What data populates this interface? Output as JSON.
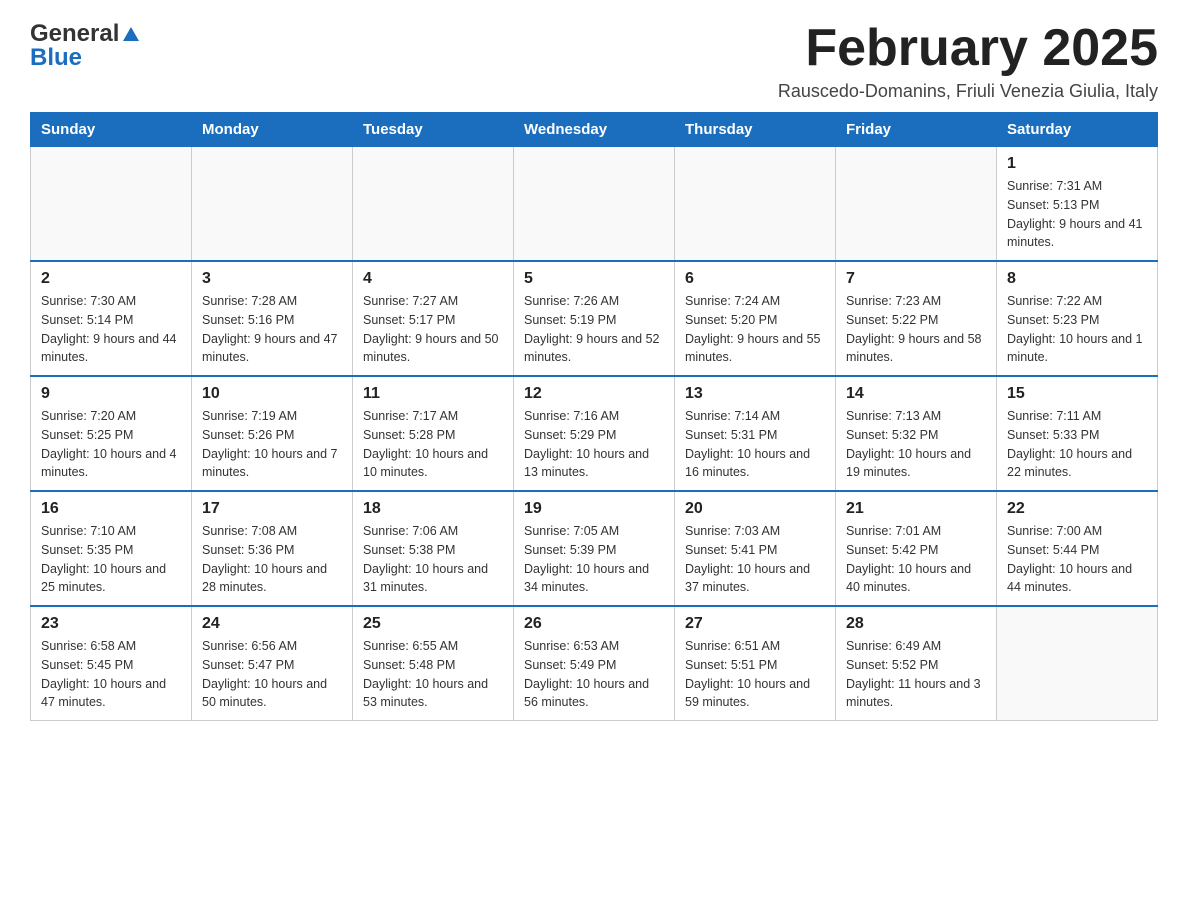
{
  "logo": {
    "general": "General",
    "blue": "Blue",
    "triangle": "▲"
  },
  "header": {
    "month_title": "February 2025",
    "location": "Rauscedo-Domanins, Friuli Venezia Giulia, Italy"
  },
  "weekdays": [
    "Sunday",
    "Monday",
    "Tuesday",
    "Wednesday",
    "Thursday",
    "Friday",
    "Saturday"
  ],
  "weeks": [
    {
      "days": [
        {
          "number": "",
          "info": ""
        },
        {
          "number": "",
          "info": ""
        },
        {
          "number": "",
          "info": ""
        },
        {
          "number": "",
          "info": ""
        },
        {
          "number": "",
          "info": ""
        },
        {
          "number": "",
          "info": ""
        },
        {
          "number": "1",
          "info": "Sunrise: 7:31 AM\nSunset: 5:13 PM\nDaylight: 9 hours and 41 minutes."
        }
      ]
    },
    {
      "days": [
        {
          "number": "2",
          "info": "Sunrise: 7:30 AM\nSunset: 5:14 PM\nDaylight: 9 hours and 44 minutes."
        },
        {
          "number": "3",
          "info": "Sunrise: 7:28 AM\nSunset: 5:16 PM\nDaylight: 9 hours and 47 minutes."
        },
        {
          "number": "4",
          "info": "Sunrise: 7:27 AM\nSunset: 5:17 PM\nDaylight: 9 hours and 50 minutes."
        },
        {
          "number": "5",
          "info": "Sunrise: 7:26 AM\nSunset: 5:19 PM\nDaylight: 9 hours and 52 minutes."
        },
        {
          "number": "6",
          "info": "Sunrise: 7:24 AM\nSunset: 5:20 PM\nDaylight: 9 hours and 55 minutes."
        },
        {
          "number": "7",
          "info": "Sunrise: 7:23 AM\nSunset: 5:22 PM\nDaylight: 9 hours and 58 minutes."
        },
        {
          "number": "8",
          "info": "Sunrise: 7:22 AM\nSunset: 5:23 PM\nDaylight: 10 hours and 1 minute."
        }
      ]
    },
    {
      "days": [
        {
          "number": "9",
          "info": "Sunrise: 7:20 AM\nSunset: 5:25 PM\nDaylight: 10 hours and 4 minutes."
        },
        {
          "number": "10",
          "info": "Sunrise: 7:19 AM\nSunset: 5:26 PM\nDaylight: 10 hours and 7 minutes."
        },
        {
          "number": "11",
          "info": "Sunrise: 7:17 AM\nSunset: 5:28 PM\nDaylight: 10 hours and 10 minutes."
        },
        {
          "number": "12",
          "info": "Sunrise: 7:16 AM\nSunset: 5:29 PM\nDaylight: 10 hours and 13 minutes."
        },
        {
          "number": "13",
          "info": "Sunrise: 7:14 AM\nSunset: 5:31 PM\nDaylight: 10 hours and 16 minutes."
        },
        {
          "number": "14",
          "info": "Sunrise: 7:13 AM\nSunset: 5:32 PM\nDaylight: 10 hours and 19 minutes."
        },
        {
          "number": "15",
          "info": "Sunrise: 7:11 AM\nSunset: 5:33 PM\nDaylight: 10 hours and 22 minutes."
        }
      ]
    },
    {
      "days": [
        {
          "number": "16",
          "info": "Sunrise: 7:10 AM\nSunset: 5:35 PM\nDaylight: 10 hours and 25 minutes."
        },
        {
          "number": "17",
          "info": "Sunrise: 7:08 AM\nSunset: 5:36 PM\nDaylight: 10 hours and 28 minutes."
        },
        {
          "number": "18",
          "info": "Sunrise: 7:06 AM\nSunset: 5:38 PM\nDaylight: 10 hours and 31 minutes."
        },
        {
          "number": "19",
          "info": "Sunrise: 7:05 AM\nSunset: 5:39 PM\nDaylight: 10 hours and 34 minutes."
        },
        {
          "number": "20",
          "info": "Sunrise: 7:03 AM\nSunset: 5:41 PM\nDaylight: 10 hours and 37 minutes."
        },
        {
          "number": "21",
          "info": "Sunrise: 7:01 AM\nSunset: 5:42 PM\nDaylight: 10 hours and 40 minutes."
        },
        {
          "number": "22",
          "info": "Sunrise: 7:00 AM\nSunset: 5:44 PM\nDaylight: 10 hours and 44 minutes."
        }
      ]
    },
    {
      "days": [
        {
          "number": "23",
          "info": "Sunrise: 6:58 AM\nSunset: 5:45 PM\nDaylight: 10 hours and 47 minutes."
        },
        {
          "number": "24",
          "info": "Sunrise: 6:56 AM\nSunset: 5:47 PM\nDaylight: 10 hours and 50 minutes."
        },
        {
          "number": "25",
          "info": "Sunrise: 6:55 AM\nSunset: 5:48 PM\nDaylight: 10 hours and 53 minutes."
        },
        {
          "number": "26",
          "info": "Sunrise: 6:53 AM\nSunset: 5:49 PM\nDaylight: 10 hours and 56 minutes."
        },
        {
          "number": "27",
          "info": "Sunrise: 6:51 AM\nSunset: 5:51 PM\nDaylight: 10 hours and 59 minutes."
        },
        {
          "number": "28",
          "info": "Sunrise: 6:49 AM\nSunset: 5:52 PM\nDaylight: 11 hours and 3 minutes."
        },
        {
          "number": "",
          "info": ""
        }
      ]
    }
  ]
}
